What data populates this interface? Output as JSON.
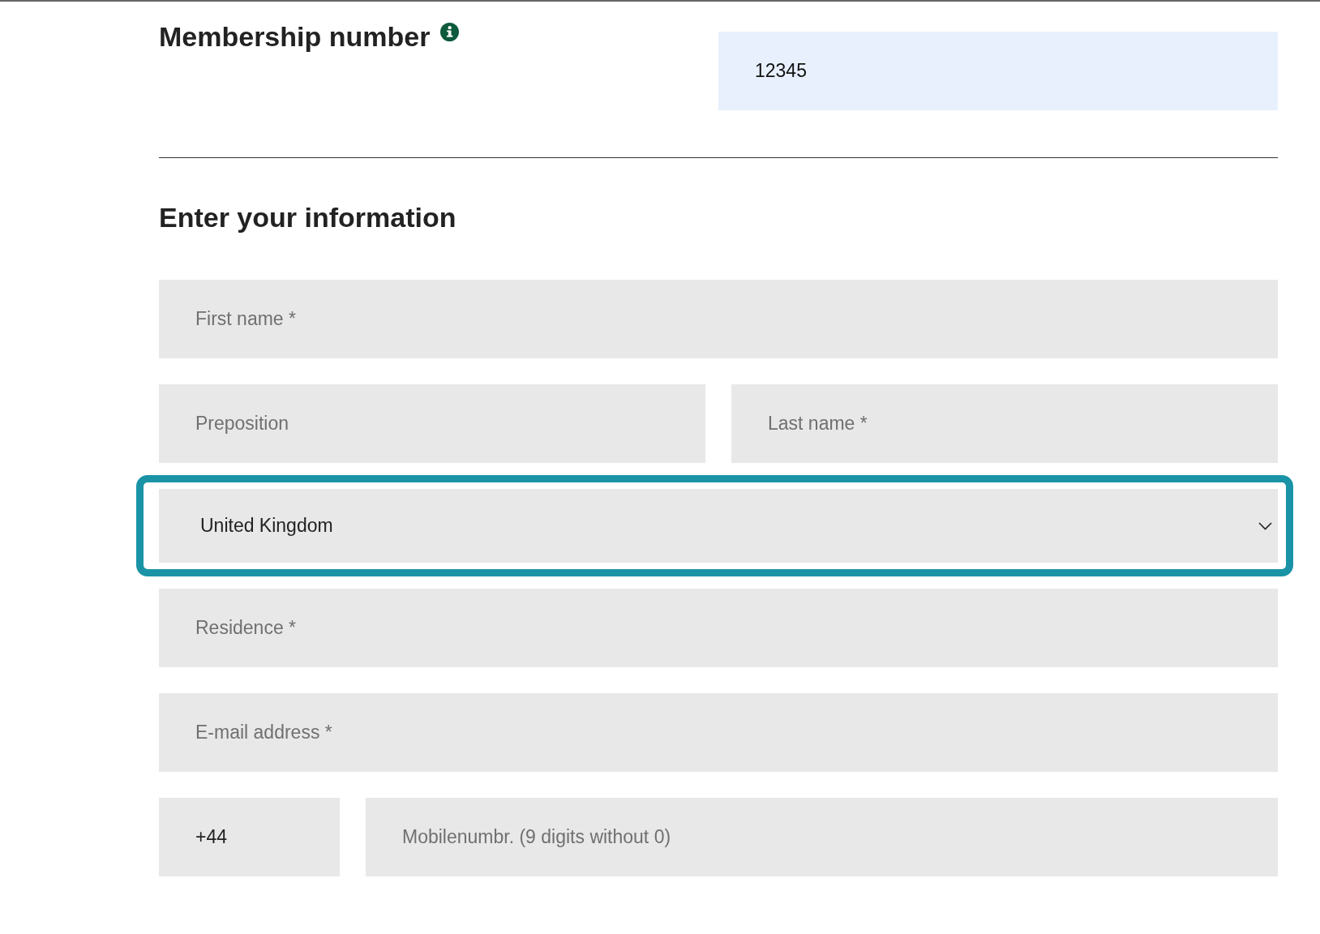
{
  "membership": {
    "label": "Membership number",
    "value": "12345"
  },
  "personal_info": {
    "title": "Enter your information",
    "rows": [
      {
        "fields": [
          {
            "kind": "text",
            "placeholder": "First name *",
            "focused": false
          }
        ]
      },
      {
        "fields": [
          {
            "kind": "text",
            "placeholder": "Preposition",
            "focused": false
          },
          {
            "kind": "text",
            "placeholder": "Last name *",
            "focused": false
          }
        ]
      },
      {
        "fields": [
          {
            "kind": "select",
            "value": "United Kingdom",
            "focused": true
          }
        ]
      },
      {
        "fields": [
          {
            "kind": "text",
            "placeholder": "Residence *",
            "focused": false
          }
        ]
      },
      {
        "fields": [
          {
            "kind": "text",
            "placeholder": "E-mail address *",
            "focused": false
          }
        ]
      },
      {
        "fields": [
          {
            "kind": "phone-code",
            "value": "+44",
            "focused": false
          },
          {
            "kind": "text",
            "placeholder": "Mobilenumbr. (9 digits without 0)",
            "focused": false
          }
        ]
      }
    ]
  }
}
